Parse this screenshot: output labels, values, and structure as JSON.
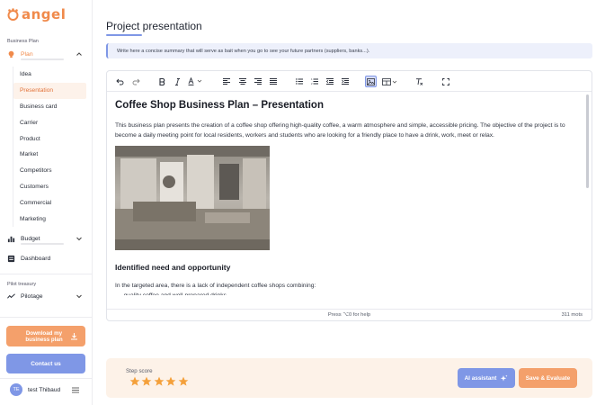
{
  "app": {
    "logo_text": "angel"
  },
  "sidebar": {
    "section_business_plan": "Business Plan",
    "plan_label": "Plan",
    "plan_subitems": [
      "Idea",
      "Presentation",
      "Business card",
      "Carrier",
      "Product",
      "Market",
      "Competitors",
      "Customers",
      "Commercial",
      "Marketing"
    ],
    "active_subitem": "Presentation",
    "budget_label": "Budget",
    "dashboard_label": "Dashboard",
    "section_pilot": "Pilot treasury",
    "pilotage_label": "Pilotage",
    "download_label": "Download my business plan",
    "contact_label": "Contact us",
    "user": {
      "initials": "TE",
      "name": "test Thibaud"
    }
  },
  "main": {
    "title": "Project presentation",
    "hint": "Write here a concise summary that will serve as bait when you go to see your future partners (suppliers, banks...).",
    "editor": {
      "heading": "Coffee Shop Business Plan – Presentation",
      "paragraph": "This business plan presents the creation of a coffee shop offering high-quality coffee, a warm atmosphere and simple, accessible pricing. The objective of the project is to become a daily meeting point for local residents, workers and students who are looking for a friendly place to have a drink, work, meet or relax.",
      "subheading": "Identified need and opportunity",
      "paragraph2": "In the targeted area, there is a lack of independent coffee shops combining:",
      "bullet_cut": "– quality coffee and well-prepared drinks",
      "status_help": "Press ⌥0 for help",
      "word_count": "311 mots"
    },
    "score": {
      "label": "Step score",
      "stars": 5,
      "star_color": "#f4a03a"
    },
    "ai_button": "AI assistant",
    "save_button": "Save & Evaluate"
  },
  "colors": {
    "accent_orange": "#f4a06b",
    "accent_blue": "#7f97e6"
  }
}
